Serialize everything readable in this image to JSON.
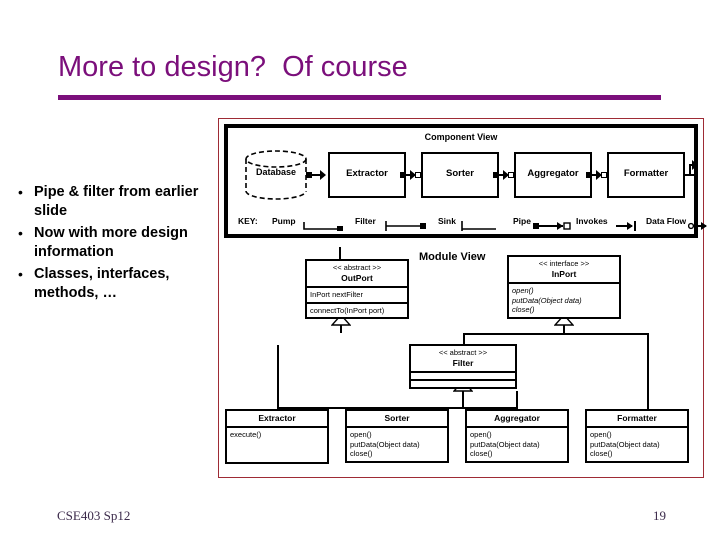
{
  "slide": {
    "title": "More to design?  Of course",
    "accent_color": "#7B0F7B",
    "bullets": [
      {
        "marker": "•",
        "text": "Pipe & filter from earlier slide"
      },
      {
        "marker": "•",
        "text": "Now with more design information"
      },
      {
        "marker": "•",
        "text": "Classes, interfaces, methods, …"
      }
    ],
    "footer": {
      "course": "CSE403 Sp12",
      "page_number": "19"
    }
  },
  "diagram": {
    "border_color": "#9E2B35",
    "component_view": {
      "title": "Component View",
      "datastore": {
        "label": "Database",
        "shape": "cylinder"
      },
      "components": [
        {
          "label": "Extractor"
        },
        {
          "label": "Sorter"
        },
        {
          "label": "Aggregator"
        },
        {
          "label": "Formatter"
        }
      ],
      "key": {
        "label": "KEY:",
        "items": [
          {
            "label": "Pump"
          },
          {
            "label": "Filter"
          },
          {
            "label": "Sink"
          },
          {
            "label": "Pipe"
          },
          {
            "label": "Invokes"
          },
          {
            "label": "Data Flow"
          }
        ]
      }
    },
    "module_view": {
      "title": "Module View",
      "classes": [
        {
          "id": "outport",
          "stereotype": "<< abstract >>",
          "name": "OutPort",
          "attributes": [
            "InPort nextFilter"
          ],
          "operations": [
            "connectTo(InPort port)"
          ]
        },
        {
          "id": "inport",
          "stereotype": "<< interface >>",
          "name": "InPort",
          "attributes": [],
          "operations": [
            "open()",
            "putData(Object data)",
            "close()"
          ]
        },
        {
          "id": "filter",
          "stereotype": "<< abstract >>",
          "name": "Filter",
          "attributes": [],
          "operations": []
        },
        {
          "id": "extractor",
          "stereotype": "",
          "name": "Extractor",
          "attributes": [],
          "operations": [
            "execute()"
          ]
        },
        {
          "id": "sorter",
          "stereotype": "",
          "name": "Sorter",
          "attributes": [],
          "operations": [
            "open()",
            "putData(Object data)",
            "close()"
          ]
        },
        {
          "id": "aggregator",
          "stereotype": "",
          "name": "Aggregator",
          "attributes": [],
          "operations": [
            "open()",
            "putData(Object data)",
            "close()"
          ]
        },
        {
          "id": "formatter",
          "stereotype": "",
          "name": "Formatter",
          "attributes": [],
          "operations": [
            "open()",
            "putData(Object data)",
            "close()"
          ]
        }
      ]
    }
  }
}
